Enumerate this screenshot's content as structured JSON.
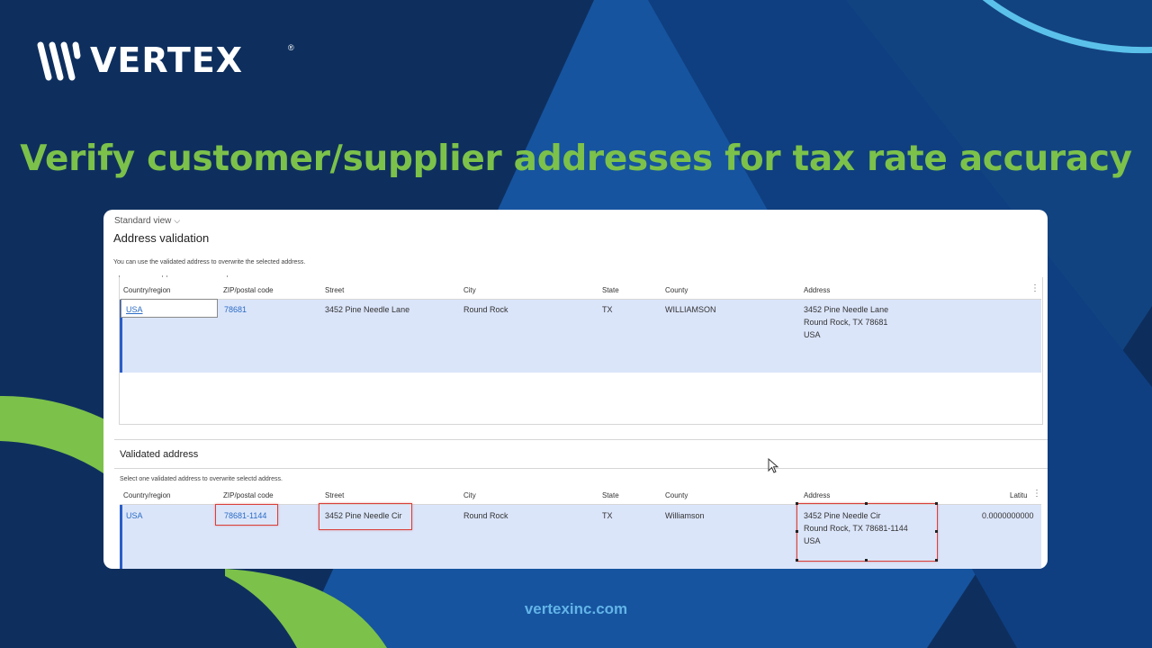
{
  "brand": {
    "name": "VERTEX",
    "reg_mark": "®"
  },
  "headline": "Verify customer/supplier addresses for tax rate accuracy",
  "footer": {
    "url": "vertexinc.com"
  },
  "colors": {
    "background": "#0e2f5e",
    "headline": "#7cc14a",
    "footer_link": "#63b4e8",
    "selection": "#dbe5fa",
    "highlight_box": "#d9403a",
    "link": "#2b6cc4"
  },
  "screenshot": {
    "view_selector": "Standard view",
    "address_validation": {
      "title": "Address validation",
      "note": "You can use the validated address to overwrite the selected address.",
      "columns": [
        "Country/region",
        "ZIP/postal code",
        "Street",
        "City",
        "State",
        "County",
        "Address"
      ],
      "row": {
        "country": "USA",
        "zip": "78681",
        "street": "3452 Pine Needle Lane",
        "city": "Round Rock",
        "state": "TX",
        "county": "WILLIAMSON",
        "address_lines": [
          "3452 Pine Needle Lane",
          "Round Rock, TX 78681",
          "USA"
        ]
      }
    },
    "validated_address": {
      "title": "Validated address",
      "note": "Select one validated address to overwrite selectd address.",
      "columns": [
        "Country/region",
        "ZIP/postal code",
        "Street",
        "City",
        "State",
        "County",
        "Address",
        "Latitu"
      ],
      "row": {
        "country": "USA",
        "zip": "78681-1144",
        "street": "3452 Pine Needle Cir",
        "city": "Round Rock",
        "state": "TX",
        "county": "Williamson",
        "address_lines": [
          "3452 Pine Needle Cir",
          "Round Rock, TX 78681-1144",
          "USA"
        ],
        "latitude": "0.0000000000"
      }
    }
  }
}
